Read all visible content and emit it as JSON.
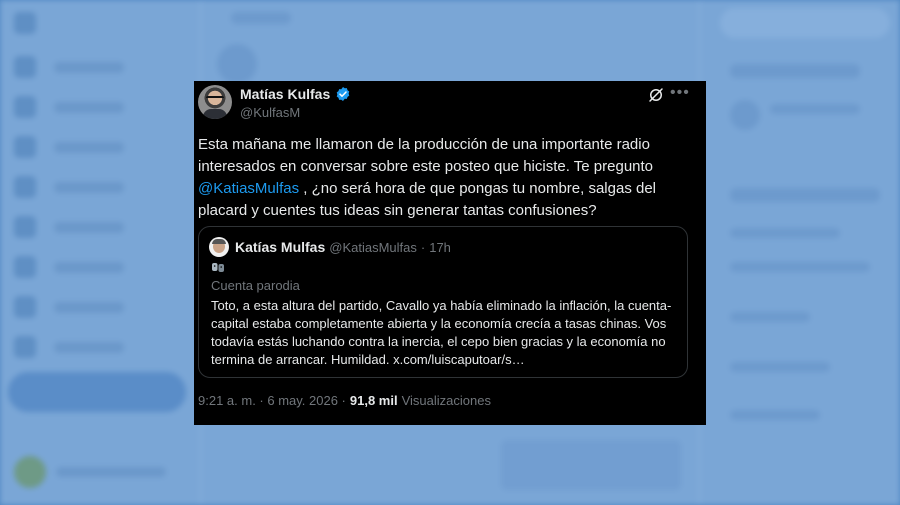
{
  "tweet": {
    "author": {
      "name": "Matías Kulfas",
      "handle": "@KulfasM",
      "verified": true,
      "verified_color": "#1d9bf0"
    },
    "text_part1": "Esta mañana me llamaron de la producción de una importante radio interesados en conversar sobre este posteo que hiciste. Te pregunto ",
    "mention": "@KatiasMulfas",
    "text_part2": " , ¿no será hora de que pongas tu nombre, salgas del placard y cuentes tus ideas sin generar tantas confusiones?",
    "quoted": {
      "name": "Katías Mulfas",
      "handle": "@KatiasMulfas",
      "separator": "·",
      "time": "17h",
      "parody_label": "Cuenta parodia",
      "text": "Toto, a esta altura del partido, Cavallo ya había eliminado la inflación, la cuenta-capital estaba completamente abierta y la economía crecía a tasas chinas. Vos todavía estás luchando contra la inercia, el cepo bien gracias y la economía no termina de arrancar. Humildad. x.com/luiscaputoar/s…"
    },
    "meta": {
      "timestamp": "9:21 a. m. · 6 may. 2026 ·",
      "views_count": "91,8 mil",
      "views_label": "Visualizaciones"
    }
  },
  "colors": {
    "background_overlay": "#4f86c2",
    "card_background": "#000000",
    "link": "#1d9bf0",
    "secondary_text": "#71767b"
  },
  "icons": [
    "verified-badge-icon",
    "grok-icon",
    "more-icon",
    "parody-mask-icon"
  ]
}
